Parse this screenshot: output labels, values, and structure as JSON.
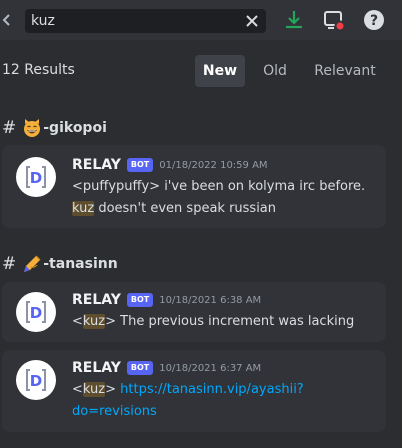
{
  "search": {
    "value": "kuz"
  },
  "results": {
    "count_label": "12 Results",
    "sort_tabs": [
      {
        "label": "New",
        "active": true
      },
      {
        "label": "Old",
        "active": false
      },
      {
        "label": "Relevant",
        "active": false
      }
    ]
  },
  "groups": [
    {
      "channel": "-gikopoi",
      "emoji": "grinning-cat-face",
      "messages": [
        {
          "author": "RELAY",
          "tag": "BOT",
          "timestamp": "01/18/2022 10:59 AM",
          "line1": "<puffypuffy> i've been on kolyma irc before.",
          "line2_highlight": "kuz",
          "line2_rest": " doesn't even speak russian"
        }
      ]
    },
    {
      "channel": "-tanasinn",
      "emoji": "writing-hand",
      "messages": [
        {
          "author": "RELAY",
          "tag": "BOT",
          "timestamp": "10/18/2021 6:38 AM",
          "prefix": "<",
          "highlight": "kuz",
          "suffix": "> The previous increment was lacking"
        },
        {
          "author": "RELAY",
          "tag": "BOT",
          "timestamp": "10/18/2021 6:37 AM",
          "prefix": "<",
          "highlight": "kuz",
          "suffix": "> ",
          "link_line1": "https://tanasinn.vip/ayashii?",
          "link_line2": "do=revisions"
        }
      ]
    }
  ],
  "colors": {
    "background": "#2b2d31",
    "card": "#313338",
    "accent": "#5865f2",
    "download": "#23a55a",
    "link": "#00a8fc",
    "highlight": "#5e4e2e"
  },
  "icons": [
    "clear-icon",
    "download-icon",
    "inbox-icon",
    "help-icon",
    "relay-avatar-icon"
  ]
}
